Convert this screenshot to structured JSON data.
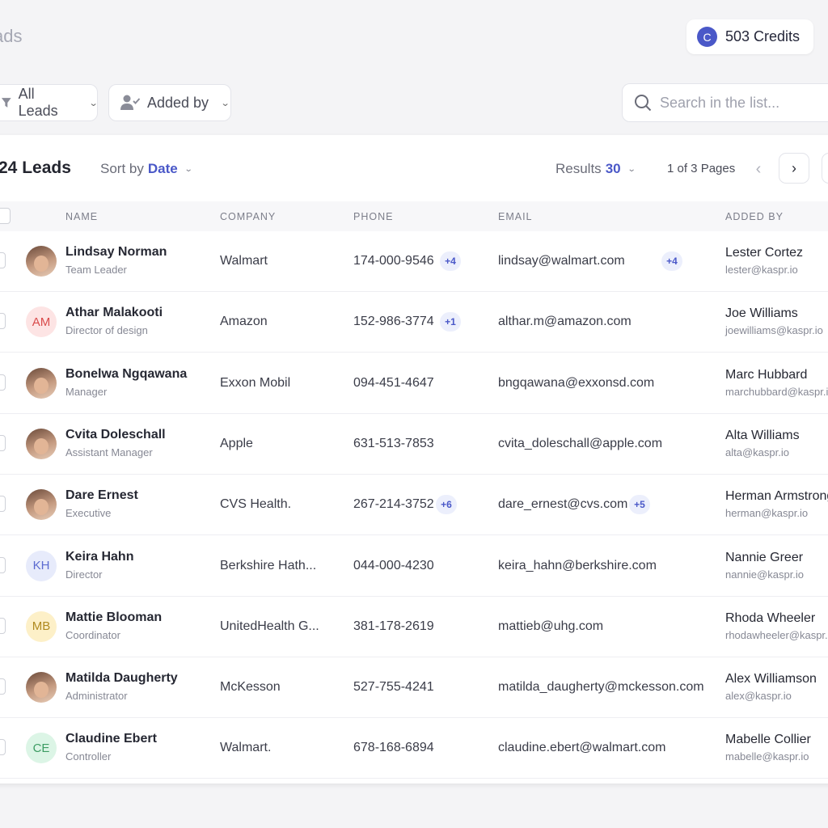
{
  "header": {
    "title": "ads",
    "credits_icon": "C",
    "credits_label": "503 Credits"
  },
  "filters": {
    "all_leads": "All Leads",
    "added_by": "Added by",
    "search_placeholder": "Search in the list..."
  },
  "list": {
    "leads_count": "24 Leads",
    "sort_label": "Sort by",
    "sort_value": "Date",
    "results_label": "Results",
    "results_value": "30",
    "pages": "1 of 3 Pages"
  },
  "columns": [
    "NAME",
    "COMPANY",
    "PHONE",
    "EMAIL",
    "ADDED BY"
  ],
  "colors": {
    "accent": "#4a58c8"
  },
  "rows": [
    {
      "name": "Lindsay Norman",
      "role": "Team Leader",
      "avatar": "",
      "avatar_type": "photo",
      "company": "Walmart",
      "phone": "174-000-9546",
      "phone_extra": "+4",
      "email": "lindsay@walmart.com",
      "email_extra": "+4",
      "added_name": "Lester Cortez",
      "added_email": "lester@kaspr.io"
    },
    {
      "name": "Athar Malakooti",
      "role": "Director of design",
      "avatar": "AM",
      "avatar_type": "initials",
      "avatar_bg": "#fde4e4",
      "avatar_fg": "#d94b4b",
      "company": "Amazon",
      "phone": "152-986-3774",
      "phone_extra": "+1",
      "email": "althar.m@amazon.com",
      "email_extra": "",
      "added_name": "Joe Williams",
      "added_email": "joewilliams@kaspr.io"
    },
    {
      "name": "Bonelwa Ngqawana",
      "role": "Manager",
      "avatar": "",
      "avatar_type": "photo",
      "company": "Exxon Mobil",
      "phone": "094-451-4647",
      "phone_extra": "",
      "email": "bngqawana@exxonsd.com",
      "email_extra": "",
      "added_name": "Marc Hubbard",
      "added_email": "marchubbard@kaspr.io"
    },
    {
      "name": "Cvita Doleschall",
      "role": "Assistant Manager",
      "avatar": "",
      "avatar_type": "photo",
      "company": "Apple",
      "phone": "631-513-7853",
      "phone_extra": "",
      "email": "cvita_doleschall@apple.com",
      "email_extra": "",
      "added_name": "Alta Williams",
      "added_email": "alta@kaspr.io"
    },
    {
      "name": "Dare Ernest",
      "role": "Executive",
      "avatar": "",
      "avatar_type": "photo",
      "company": "CVS Health.",
      "phone": "267-214-3752",
      "phone_extra": "+6",
      "email": "dare_ernest@cvs.com",
      "email_extra": "+5",
      "added_name": "Herman Armstrong",
      "added_email": "herman@kaspr.io"
    },
    {
      "name": "Keira Hahn",
      "role": "Director",
      "avatar": "KH",
      "avatar_type": "initials",
      "avatar_bg": "#e7ebfb",
      "avatar_fg": "#5b6ad0",
      "company": "Berkshire Hath...",
      "phone": "044-000-4230",
      "phone_extra": "",
      "email": "keira_hahn@berkshire.com",
      "email_extra": "",
      "added_name": "Nannie Greer",
      "added_email": "nannie@kaspr.io"
    },
    {
      "name": "Mattie Blooman",
      "role": "Coordinator",
      "avatar": "MB",
      "avatar_type": "initials",
      "avatar_bg": "#fdf0c8",
      "avatar_fg": "#b08a20",
      "company": "UnitedHealth G...",
      "phone": "381-178-2619",
      "phone_extra": "",
      "email": "mattieb@uhg.com",
      "email_extra": "",
      "added_name": "Rhoda Wheeler",
      "added_email": "rhodawheeler@kaspr.io"
    },
    {
      "name": "Matilda Daugherty",
      "role": "Administrator",
      "avatar": "",
      "avatar_type": "photo",
      "company": "McKesson",
      "phone": "527-755-4241",
      "phone_extra": "",
      "email": "matilda_daugherty@mckesson.com",
      "email_extra": "",
      "added_name": "Alex Williamson",
      "added_email": "alex@kaspr.io"
    },
    {
      "name": "Claudine Ebert",
      "role": "Controller",
      "avatar": "CE",
      "avatar_type": "initials",
      "avatar_bg": "#dcf5e6",
      "avatar_fg": "#3d9c63",
      "company": "Walmart.",
      "phone": "678-168-6894",
      "phone_extra": "",
      "email": "claudine.ebert@walmart.com",
      "email_extra": "",
      "added_name": "Mabelle Collier",
      "added_email": "mabelle@kaspr.io"
    }
  ]
}
